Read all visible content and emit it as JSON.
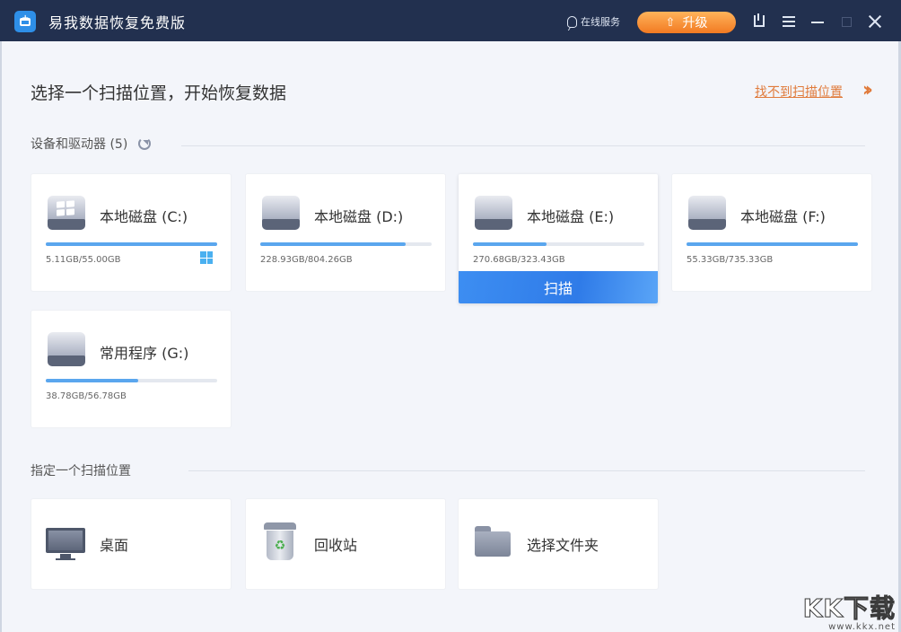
{
  "window": {
    "title": "易我数据恢复免费版",
    "online_service": "在线服务",
    "upgrade": "升级"
  },
  "main": {
    "heading": "选择一个扫描位置，开始恢复数据",
    "not_found_link": "找不到扫描位置"
  },
  "devices": {
    "section_title": "设备和驱动器 (5)",
    "scan_label": "扫描",
    "drives": [
      {
        "name": "本地磁盘 (C:)",
        "size": "5.11GB/55.00GB",
        "used_fraction": 1.0,
        "system": true
      },
      {
        "name": "本地磁盘 (D:)",
        "size": "228.93GB/804.26GB",
        "used_fraction": 0.85
      },
      {
        "name": "本地磁盘 (E:)",
        "size": "270.68GB/323.43GB",
        "used_fraction": 0.43,
        "selected": true
      },
      {
        "name": "本地磁盘 (F:)",
        "size": "55.33GB/735.33GB",
        "used_fraction": 1.0
      },
      {
        "name": "常用程序 (G:)",
        "size": "38.78GB/56.78GB",
        "used_fraction": 0.54
      }
    ]
  },
  "locations": {
    "section_title": "指定一个扫描位置",
    "items": [
      {
        "label": "桌面",
        "icon": "desktop-monitor-icon"
      },
      {
        "label": "回收站",
        "icon": "recycle-bin-icon"
      },
      {
        "label": "选择文件夹",
        "icon": "folder-icon"
      }
    ]
  },
  "watermark": {
    "big": "KK下载",
    "small": "www.kkx.net"
  },
  "colors": {
    "titlebar": "#22304f",
    "accent": "#2f7be8",
    "upgrade": "#f27a22",
    "link": "#e07b3c"
  }
}
